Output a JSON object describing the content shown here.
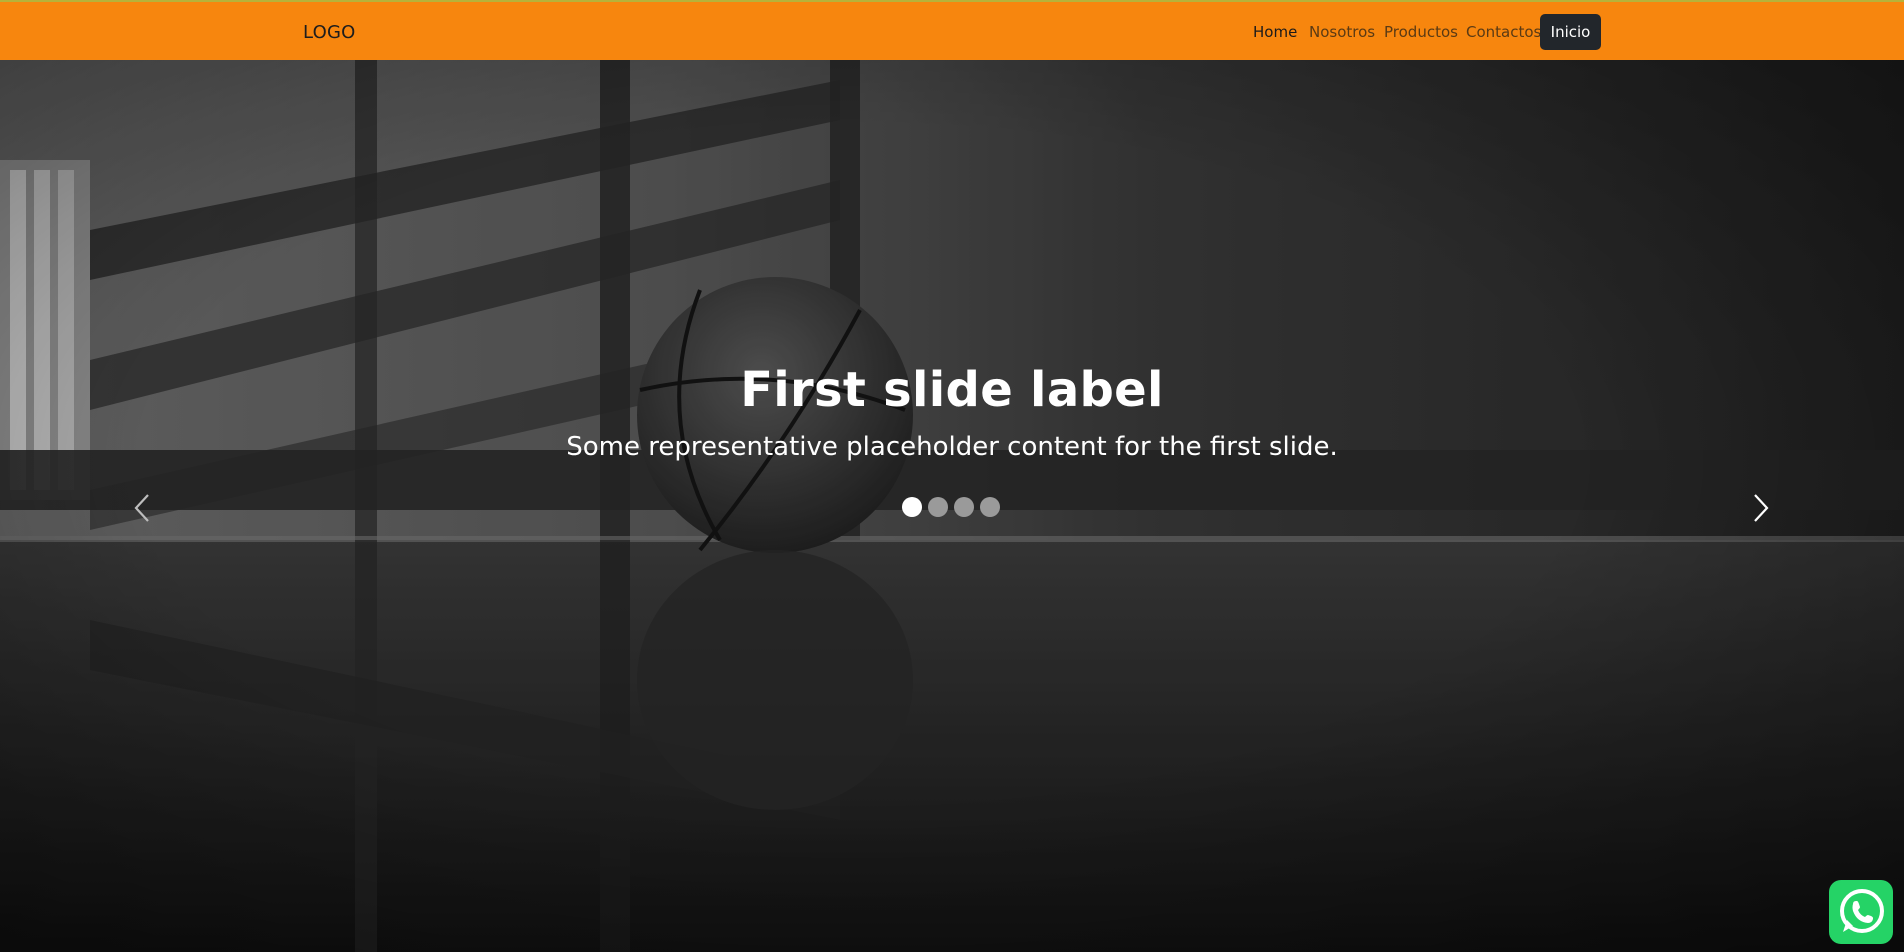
{
  "header": {
    "logo": "LOGO",
    "nav": [
      {
        "label": "Home",
        "active": true
      },
      {
        "label": "Nosotros",
        "active": false
      },
      {
        "label": "Productos",
        "active": false
      },
      {
        "label": "Contactos",
        "active": false
      }
    ],
    "cta_label": "Inicio",
    "background_color": "#f7860e"
  },
  "carousel": {
    "title": "First slide label",
    "text": "Some representative placeholder content for the first slide.",
    "slide_count": 4,
    "active_slide": 1,
    "prev_icon": "chevron-left-icon",
    "next_icon": "chevron-right-icon"
  },
  "floating": {
    "whatsapp_icon": "whatsapp-icon",
    "color": "#25d366"
  }
}
